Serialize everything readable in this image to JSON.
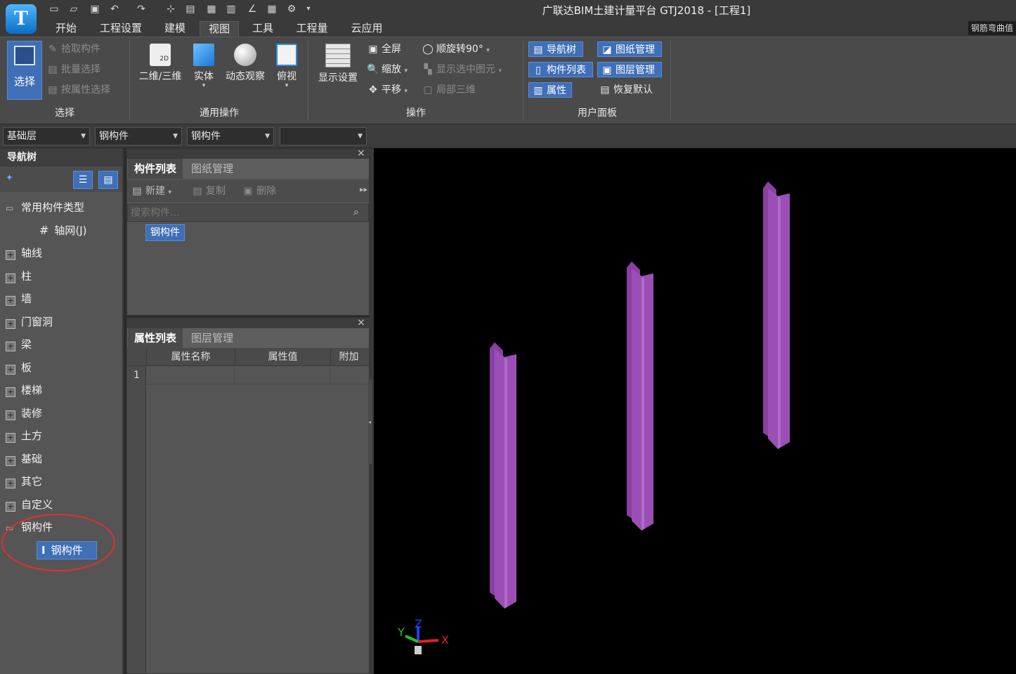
{
  "app": {
    "title": "广联达BIM土建计量平台 GTJ2018 - [工程1]",
    "logo_letter": "T",
    "top_right_badge": "钢筋弯曲值"
  },
  "menu": {
    "tabs": [
      "开始",
      "工程设置",
      "建模",
      "视图",
      "工具",
      "工程量",
      "云应用"
    ],
    "active": "视图"
  },
  "ribbon": {
    "select_group": {
      "label": "选择",
      "big_button": "选择",
      "items": [
        "拾取构件",
        "批量选择",
        "按属性选择"
      ]
    },
    "common_group": {
      "label": "通用操作",
      "buttons": [
        "二维/三维",
        "实体",
        "动态观察",
        "俯视"
      ],
      "icon_2d_text": "2D"
    },
    "operation_group": {
      "label": "操作",
      "display_settings": "显示设置",
      "col1": [
        "全屏",
        "缩放",
        "平移"
      ],
      "col2": [
        "顺旋转90°",
        "显示选中图元",
        "局部三维"
      ]
    },
    "user_panel_group": {
      "label": "用户面板",
      "col1": [
        "导航树",
        "构件列表",
        "属性"
      ],
      "col2": [
        "图纸管理",
        "图层管理",
        "恢复默认"
      ]
    }
  },
  "toolbar": {
    "floor": "基础层",
    "category": "钢构件",
    "component": "钢构件",
    "extra": ""
  },
  "nav_tree": {
    "header": "导航树",
    "common_types": "常用构件类型",
    "axis_grid": "轴网(J)",
    "items": [
      "轴线",
      "柱",
      "墙",
      "门窗洞",
      "梁",
      "板",
      "楼梯",
      "装修",
      "土方",
      "基础",
      "其它",
      "自定义"
    ],
    "steel_folder": "钢构件",
    "steel_item": "钢构件"
  },
  "component_list": {
    "tabs": [
      "构件列表",
      "图纸管理"
    ],
    "actions": [
      "新建",
      "复制",
      "删除"
    ],
    "search_placeholder": "搜索构件...",
    "items": [
      "钢构件"
    ]
  },
  "property_list": {
    "tabs": [
      "属性列表",
      "图层管理"
    ],
    "columns": [
      "属性名称",
      "属性值",
      "附加"
    ],
    "rows": [
      {
        "index": "1",
        "name": "",
        "value": "",
        "extra": ""
      }
    ]
  },
  "viewport": {
    "background": "#000000",
    "member_color": "#9b4fb5",
    "axis_labels": {
      "x": "X",
      "y": "Y",
      "z": "Z"
    }
  },
  "colors": {
    "annotation_circle": "#e03030",
    "accent_blue": "#3f6fb6"
  }
}
